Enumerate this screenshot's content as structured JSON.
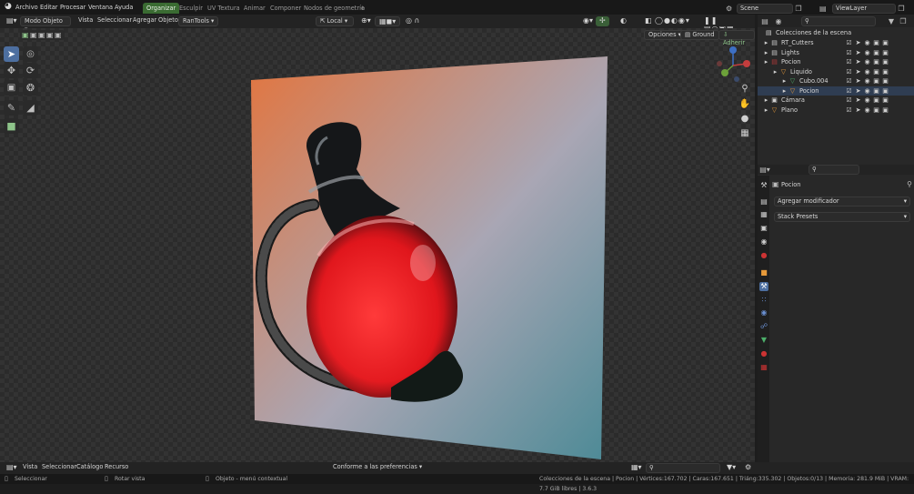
{
  "top_menu": {
    "items": [
      "Archivo",
      "Editar",
      "Procesar",
      "Ventana",
      "Ayuda"
    ],
    "workspaces": [
      "Organizar",
      "Esculpir",
      "UV Textura",
      "Animar",
      "Componer",
      "Nodos de geometría"
    ],
    "active_workspace": "Organizar",
    "add_tab": "+",
    "scene": "Scene",
    "view_layer": "ViewLayer"
  },
  "viewport_header": {
    "mode": "Modo Objeto",
    "menus": [
      "Vista",
      "Seleccionar",
      "Agregar",
      "Objeto"
    ],
    "addon": "RanTools",
    "orientation": "Local",
    "options": "Opciones",
    "ground": "Ground",
    "snap": "Adherir"
  },
  "outliner": {
    "title": "Colecciones de la escena",
    "search_placeholder": "",
    "rows": [
      {
        "label": "RT_Cutters",
        "depth": 1,
        "type": "collection"
      },
      {
        "label": "Lights",
        "depth": 1,
        "type": "collection"
      },
      {
        "label": "Pocion",
        "depth": 1,
        "type": "collection",
        "color": "#b03a3a"
      },
      {
        "label": "Liquido",
        "depth": 2,
        "type": "object"
      },
      {
        "label": "Cubo.004",
        "depth": 3,
        "type": "mesh"
      },
      {
        "label": "Pocion",
        "depth": 3,
        "type": "object",
        "selected": true
      },
      {
        "label": "Cámara",
        "depth": 1,
        "type": "camera"
      },
      {
        "label": "Plano",
        "depth": 1,
        "type": "object"
      }
    ]
  },
  "properties": {
    "object_name": "Pocion",
    "add_modifier": "Agregar modificador",
    "stack_presets": "Stack Presets"
  },
  "bottom_bar": {
    "menus": [
      "Vista",
      "Seleccionar",
      "Catálogo",
      "Recurso"
    ],
    "preference": "Conforme a las preferencias"
  },
  "status_bar": {
    "select": "Seleccionar",
    "rotate": "Rotar vista",
    "context": "Objeto - menú contextual",
    "stats": "Colecciones de la escena | Pocion | Vértices:167.702 | Caras:167.651 | Triáng:335.302 | Objetos:0/13 | Memoria: 281.9 MiB | VRAM: 7.7 GiB libres | 3.6.3"
  },
  "colors": {
    "accent_blue": "#4d6fa0",
    "workspace_green": "#3a6b32",
    "liquid_red": "#e0161c",
    "backdrop_orange": "#e2753f",
    "backdrop_blue": "#4d8a96"
  },
  "icons": {
    "select": "select-box-icon",
    "cursor": "cursor-icon",
    "move": "move-icon",
    "rotate": "rotate-icon",
    "scale": "scale-icon",
    "transform": "transform-icon",
    "annotate": "annotate-icon",
    "measure": "measure-icon",
    "add_cube": "add-cube-icon"
  }
}
